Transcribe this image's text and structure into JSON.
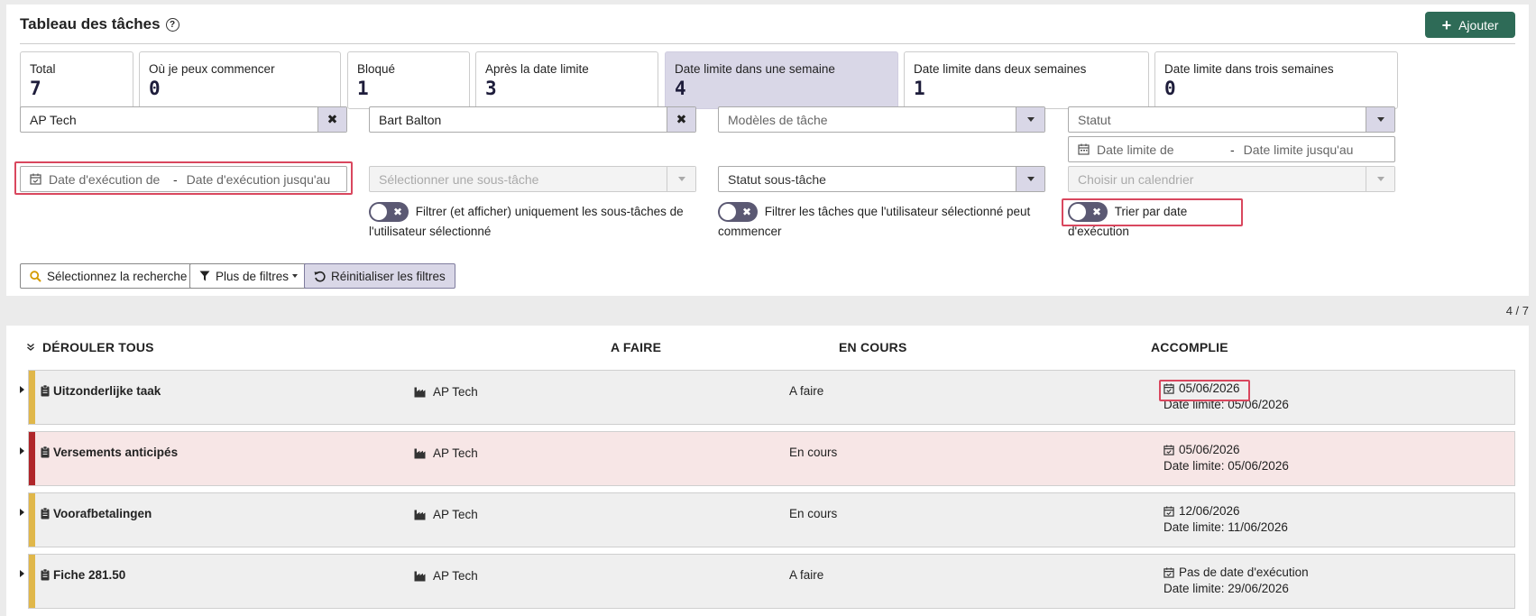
{
  "header": {
    "title": "Tableau des tâches",
    "help_icon": "question-circle-icon",
    "add_label": "Ajouter"
  },
  "cards": [
    {
      "label": "Total",
      "value": "7"
    },
    {
      "label": "Où je peux commencer",
      "value": "0"
    },
    {
      "label": "Bloqué",
      "value": "1"
    },
    {
      "label": "Après la date limite",
      "value": "3"
    },
    {
      "label": "Date limite dans une semaine",
      "value": "4"
    },
    {
      "label": "Date limite dans deux semaines",
      "value": "1"
    },
    {
      "label": "Date limite dans trois semaines",
      "value": "0"
    }
  ],
  "filters": {
    "company": {
      "value": "AP Tech"
    },
    "user": {
      "value": "Bart Balton"
    },
    "task_models": {
      "placeholder": "Modèles de tâche"
    },
    "status": {
      "placeholder": "Statut"
    },
    "due_date": {
      "from": "Date limite de",
      "to": "Date limite jusqu'au"
    },
    "execution_date": {
      "from": "Date d'exécution de",
      "to": "Date d'exécution jusqu'au"
    },
    "subtask": {
      "placeholder": "Sélectionner une sous-tâche"
    },
    "subtask_status": {
      "placeholder": "Statut sous-tâche"
    },
    "calendar": {
      "placeholder": "Choisir un calendrier"
    },
    "separator": "-"
  },
  "toggles": {
    "subtasks_only": "Filtrer (et afficher) uniquement les sous-tâches de l'utilisateur sélectionné",
    "can_start": "Filtrer les tâches que l'utilisateur sélectionné peut commencer",
    "sort_exec": "Trier par date d'exécution"
  },
  "toolbar": {
    "search": "Sélectionnez la recherche",
    "more_filters": "Plus de filtres",
    "reset": "Réinitialiser les filtres"
  },
  "counter": "4 / 7",
  "columns": {
    "expand_all": "DÉROULER TOUS",
    "todo": "A FAIRE",
    "in_progress": "EN COURS",
    "done": "ACCOMPLIE"
  },
  "tasks": [
    {
      "name": "Uitzonderlijke taak",
      "company": "AP Tech",
      "status": "A faire",
      "exec_date": "05/06/2026",
      "due": "Date limite: 05/06/2026",
      "overdue": false
    },
    {
      "name": "Versements anticipés",
      "company": "AP Tech",
      "status": "En cours",
      "exec_date": "05/06/2026",
      "due": "Date limite: 05/06/2026",
      "overdue": true
    },
    {
      "name": "Voorafbetalingen",
      "company": "AP Tech",
      "status": "En cours",
      "exec_date": "12/06/2026",
      "due": "Date limite: 11/06/2026",
      "overdue": false
    },
    {
      "name": "Fiche 281.50",
      "company": "AP Tech",
      "status": "A faire",
      "exec_date": "Pas de date d'exécution",
      "due": "Date limite: 29/06/2026",
      "overdue": false
    }
  ],
  "colors": {
    "accent": "#2e6b57",
    "active_card": "#d9d7e7",
    "highlight": "#d9475e",
    "bar_normal": "#e0b74a",
    "bar_overdue": "#b0262a"
  }
}
